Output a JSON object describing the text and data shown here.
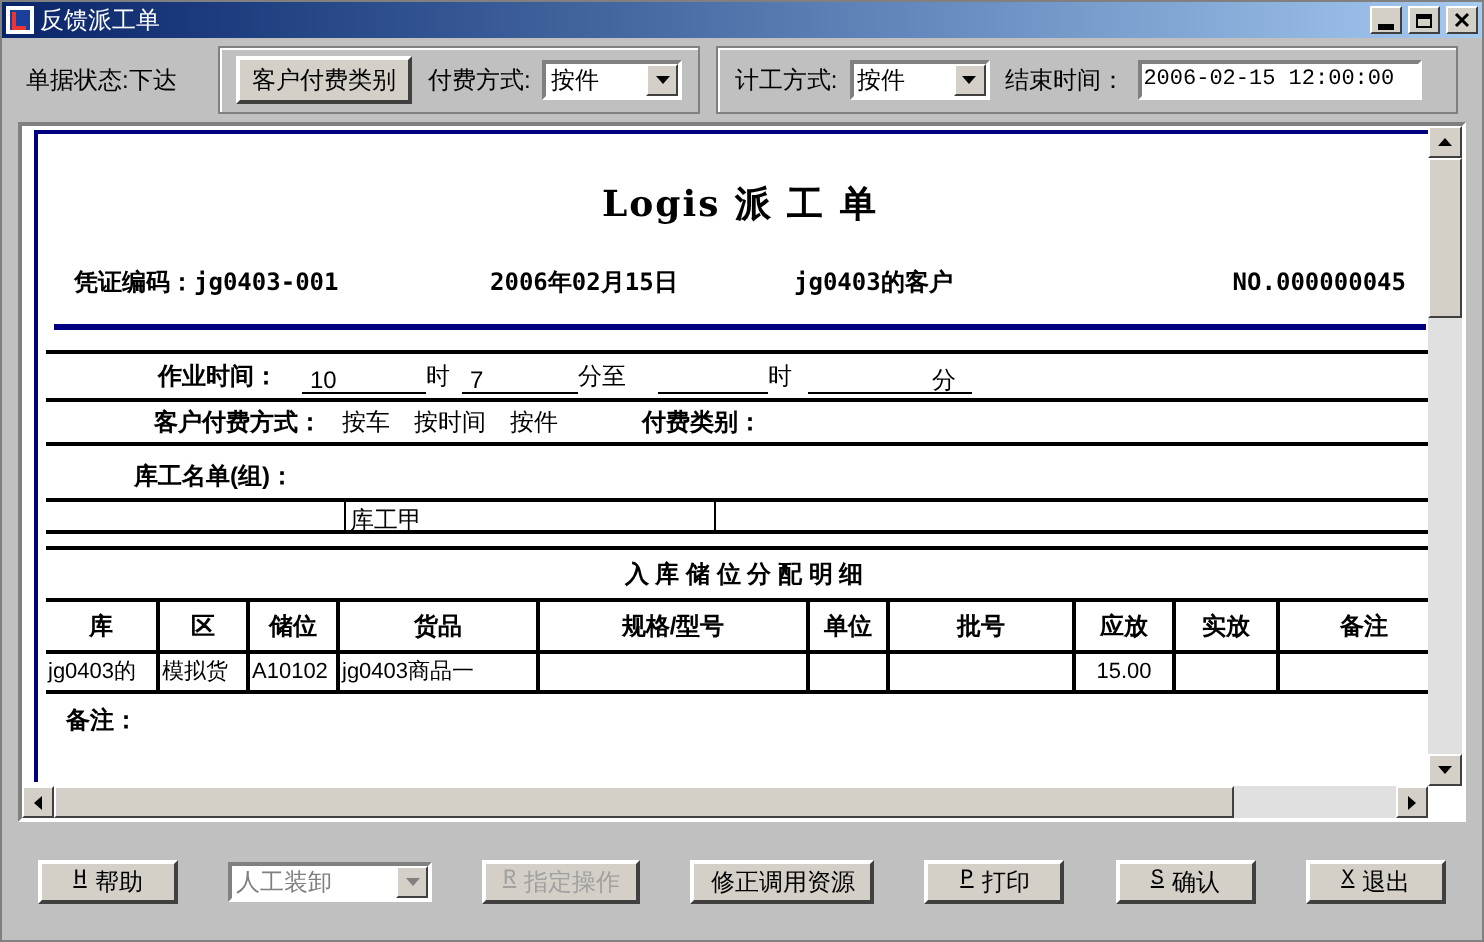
{
  "window": {
    "title": "反馈派工单"
  },
  "toolbar": {
    "status": {
      "label": "单据状态:",
      "value": "下达"
    },
    "customer_payment_button": "客户付费类别",
    "payment_method": {
      "label": "付费方式:",
      "value": "按件"
    },
    "work_method": {
      "label": "计工方式:",
      "value": "按件"
    },
    "end_time": {
      "label": "结束时间：",
      "value": "2006-02-15 12:00:00"
    }
  },
  "document": {
    "title": "Logis 派 工 单",
    "header": [
      "凭证编码：jg0403-001",
      "2006年02月15日",
      "jg0403的客户",
      "NO.000000045"
    ],
    "work_time": {
      "label": "作业时间：",
      "start_hour": "10",
      "hour_unit_1": "时",
      "start_minute": "7",
      "minute_to": "分至",
      "hour_unit_2": "时",
      "minute_unit": "分"
    },
    "payment": {
      "label": "客户付费方式：",
      "options": [
        "按车",
        "按时间",
        "按件"
      ],
      "category_label": "付费类别："
    },
    "workers": {
      "label": "库工名单(组)：",
      "worker": "库工甲"
    },
    "detail": {
      "title": "入 库 储 位 分 配 明 细",
      "columns": [
        "库",
        "区",
        "储位",
        "货品",
        "规格/型号",
        "单位",
        "批号",
        "应放",
        "实放",
        "备注"
      ],
      "rows": [
        {
          "cells": [
            "jg0403的",
            "模拟货",
            "A10102",
            "jg0403商品一",
            null,
            null,
            null,
            "15.00",
            null,
            null
          ]
        }
      ]
    },
    "remarks_label": "备注："
  },
  "buttons": [
    {
      "kind": "button",
      "key": "H",
      "label": "帮助",
      "disabled": false
    },
    {
      "kind": "dropdown",
      "value": "人工装卸",
      "disabled": true
    },
    {
      "kind": "button",
      "key": "R",
      "label": "指定操作",
      "disabled": true
    },
    {
      "kind": "button",
      "label": "修正调用资源",
      "disabled": false
    },
    {
      "kind": "button",
      "key": "P",
      "label": "打印",
      "disabled": false
    },
    {
      "kind": "button",
      "key": "S",
      "label": "确认",
      "disabled": false
    },
    {
      "kind": "button",
      "key": "X",
      "label": "退出",
      "disabled": false
    }
  ]
}
